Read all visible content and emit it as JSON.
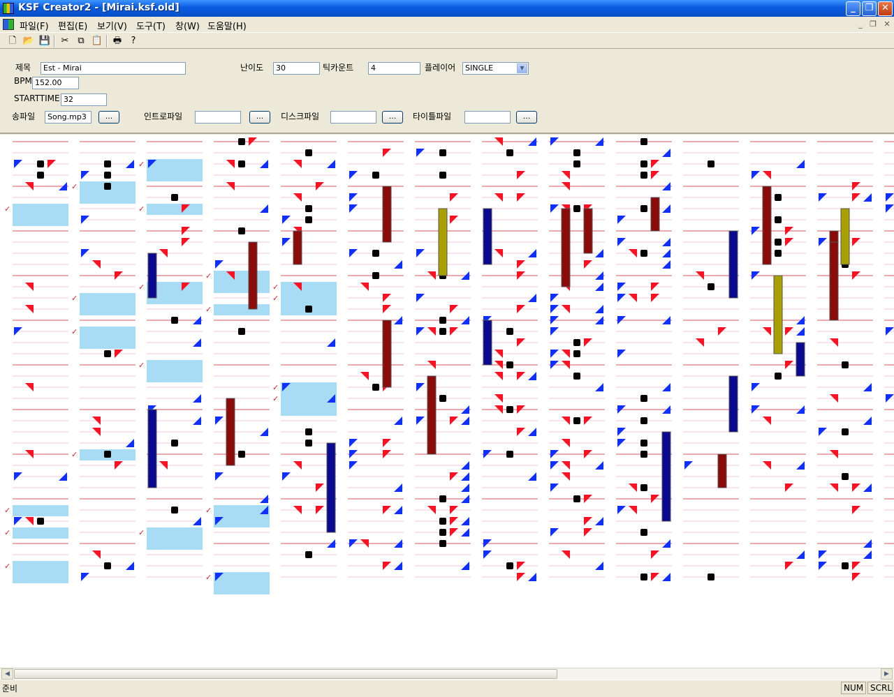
{
  "window": {
    "title": "KSF Creator2 - [Mirai.ksf.old]"
  },
  "menu": [
    "파일(F)",
    "편집(E)",
    "보기(V)",
    "도구(T)",
    "창(W)",
    "도움말(H)"
  ],
  "toolbar_icons": [
    "new-file-icon",
    "open-folder-icon",
    "save-icon",
    "cut-icon",
    "copy-icon",
    "paste-icon",
    "print-icon",
    "help-icon"
  ],
  "form": {
    "title_label": "제목",
    "title_value": "Est - Mirai",
    "bpm_label": "BPM",
    "bpm_value": "152.00",
    "starttime_label": "STARTTIME",
    "starttime_value": "32",
    "difficulty_label": "난이도",
    "difficulty_value": "30",
    "tickcount_label": "틱카운트",
    "tickcount_value": "4",
    "player_label": "플레이어",
    "player_value": "SINGLE",
    "song_label": "송파일",
    "song_value": "Song.mp3",
    "intro_label": "인트로파일",
    "intro_value": "",
    "disc_label": "디스크파일",
    "disc_value": "",
    "titlefile_label": "타이틀파일",
    "titlefile_value": "",
    "browse_label": "..."
  },
  "colors": {
    "note_blue": "#1030ff",
    "note_red": "#ff1020",
    "note_center": "#000000",
    "hold_blue": "#0a0a90",
    "hold_red": "#8b0a0a",
    "hold_yellow": "#a8a000",
    "select": "#a8dcf5",
    "beat_line": "#e05060",
    "row_line": "#f4c8d8",
    "check": "#d02020"
  },
  "status": {
    "text": "준비",
    "num": "NUM",
    "scrl": "SCRL"
  }
}
